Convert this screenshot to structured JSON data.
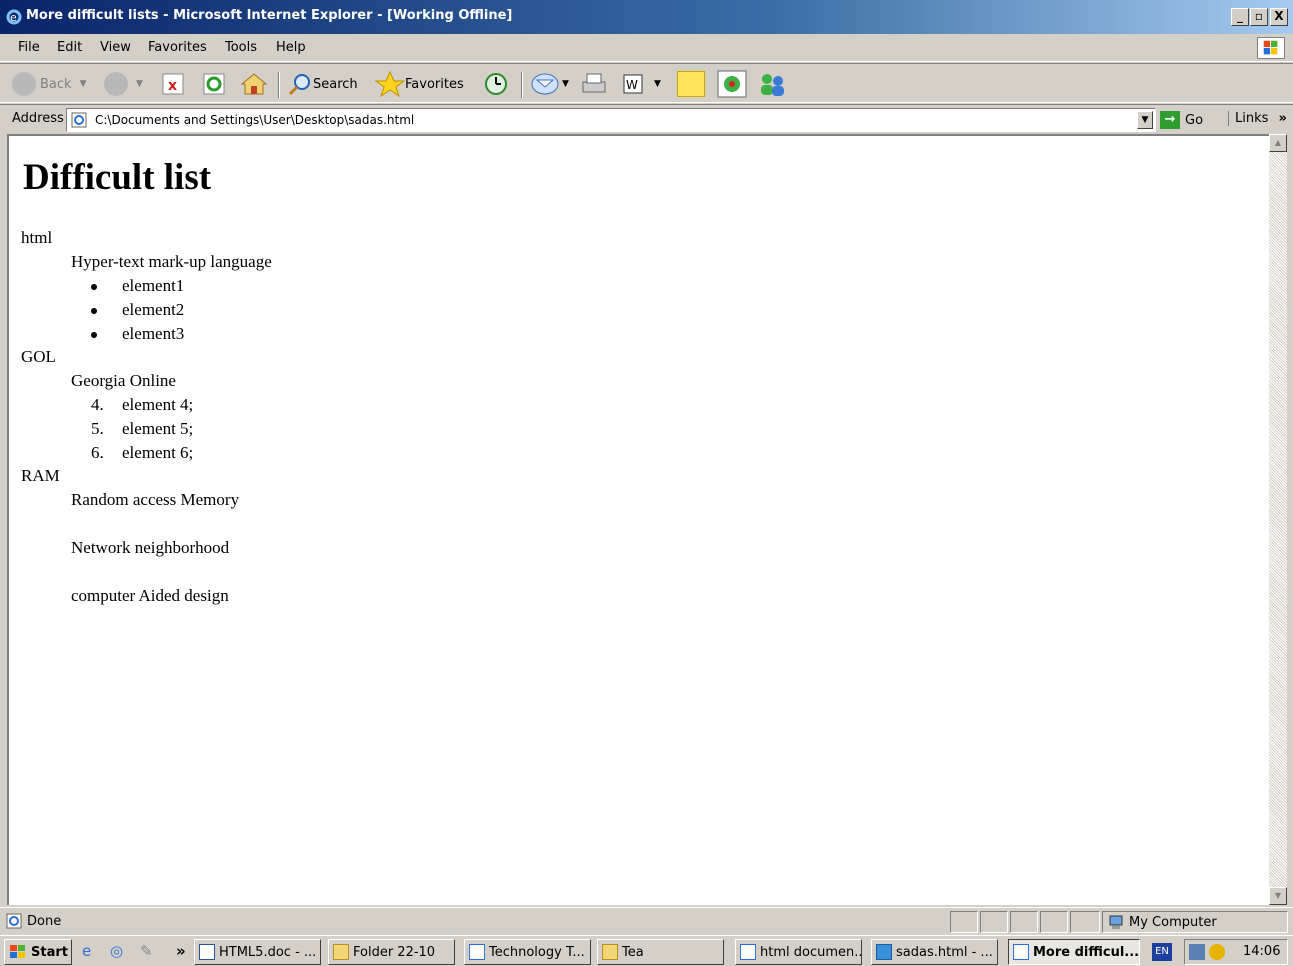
{
  "window": {
    "title": "More difficult lists - Microsoft Internet Explorer - [Working Offline]",
    "min_label": "_",
    "max_label": "8",
    "close_label": "X"
  },
  "menu": [
    "File",
    "Edit",
    "View",
    "Favorites",
    "Tools",
    "Help"
  ],
  "toolbar": {
    "back_label": "Back",
    "search_label": "Search",
    "favorites_label": "Favorites"
  },
  "address": {
    "label": "Address",
    "value": "C:\\Documents and Settings\\User\\Desktop\\sadas.html",
    "go_label": "Go",
    "links_label": "Links"
  },
  "page": {
    "heading": "Difficult list",
    "dl": [
      {
        "term": "html",
        "definition": "Hyper-text mark-up language",
        "list_type": "ul",
        "items": [
          "element1",
          "element2",
          "element3"
        ]
      },
      {
        "term": "GOL",
        "definition": "Georgia Online",
        "list_type": "ol",
        "markers": [
          "4.",
          "5.",
          "6."
        ],
        "items": [
          "element 4;",
          "element 5;",
          "element 6;"
        ]
      },
      {
        "term": "RAM",
        "definition": "Random access Memory"
      },
      {
        "definition": "Network neighborhood"
      },
      {
        "definition": "computer Aided design"
      }
    ]
  },
  "status": {
    "text": "Done",
    "zone": "My Computer"
  },
  "taskbar": {
    "start_label": "Start",
    "tasks": [
      "HTML5.doc - ...",
      "Folder 22-10",
      "Technology T...",
      "Tea",
      "html documen...",
      "sadas.html - ...",
      "More difficul..."
    ],
    "lang": "EN",
    "clock": "14:06"
  }
}
